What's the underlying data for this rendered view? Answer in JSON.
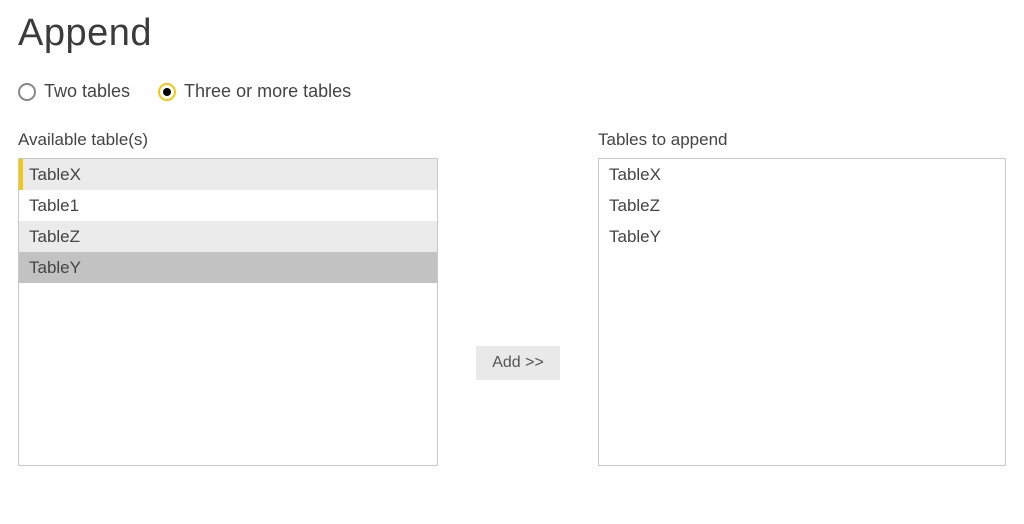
{
  "title": "Append",
  "radios": {
    "two": {
      "label": "Two tables",
      "selected": false
    },
    "three": {
      "label": "Three or more tables",
      "selected": true
    }
  },
  "available": {
    "label": "Available table(s)",
    "items": [
      {
        "name": "TableX",
        "shaded": true,
        "hl": true,
        "active": false
      },
      {
        "name": "Table1",
        "shaded": false,
        "hl": false,
        "active": false
      },
      {
        "name": "TableZ",
        "shaded": true,
        "hl": false,
        "active": false
      },
      {
        "name": "TableY",
        "shaded": true,
        "hl": false,
        "active": true
      }
    ]
  },
  "append": {
    "label": "Tables to append",
    "items": [
      {
        "name": "TableX"
      },
      {
        "name": "TableZ"
      },
      {
        "name": "TableY"
      }
    ]
  },
  "add_label": "Add >>"
}
